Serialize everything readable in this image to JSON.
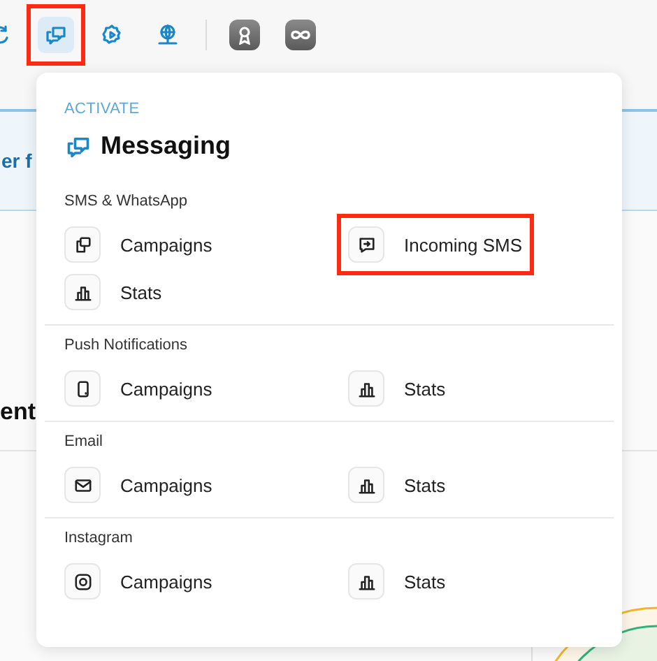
{
  "toolbar": [
    {
      "kind": "sync",
      "selected": false,
      "highlighted": false
    },
    {
      "kind": "chat",
      "selected": true,
      "highlighted": true
    },
    {
      "kind": "gear",
      "selected": false,
      "highlighted": false
    },
    {
      "kind": "globe",
      "selected": false,
      "highlighted": false
    },
    {
      "kind": "divider",
      "selected": false,
      "highlighted": false
    },
    {
      "kind": "award",
      "selected": false,
      "highlighted": false
    },
    {
      "kind": "infinity",
      "selected": false,
      "highlighted": false
    }
  ],
  "background": {
    "banner_text": "er f",
    "heading": "ent"
  },
  "menu": {
    "eyebrow": "ACTIVATE",
    "title": "Messaging",
    "sections": [
      {
        "label": "SMS & WhatsApp",
        "items": [
          {
            "label": "Campaigns",
            "kind": "cards",
            "highlighted": false
          },
          {
            "label": "Incoming SMS",
            "kind": "inbox",
            "highlighted": true
          },
          {
            "label": "Stats",
            "kind": "stats",
            "highlighted": false
          }
        ]
      },
      {
        "label": "Push Notifications",
        "items": [
          {
            "label": "Campaigns",
            "kind": "phone",
            "highlighted": false
          },
          {
            "label": "Stats",
            "kind": "stats",
            "highlighted": false
          }
        ]
      },
      {
        "label": "Email",
        "items": [
          {
            "label": "Campaigns",
            "kind": "mail",
            "highlighted": false
          },
          {
            "label": "Stats",
            "kind": "stats",
            "highlighted": false
          }
        ]
      },
      {
        "label": "Instagram",
        "items": [
          {
            "label": "Campaigns",
            "kind": "camera",
            "highlighted": false
          },
          {
            "label": "Stats",
            "kind": "stats",
            "highlighted": false
          }
        ]
      }
    ]
  }
}
